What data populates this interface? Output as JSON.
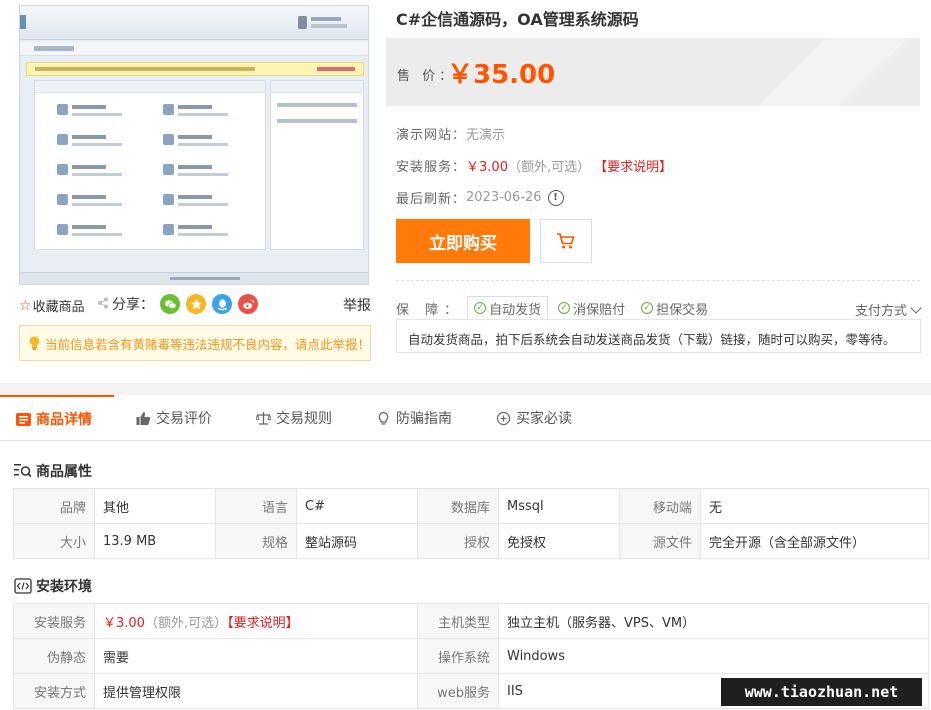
{
  "product": {
    "title": "C#企信通源码，OA管理系统源码",
    "price_label": "售 价：",
    "price": "￥35.00"
  },
  "info": {
    "demo_label": "演示网站：",
    "demo_value": "无演示",
    "install_label": "安装服务：",
    "install_price": "￥3.00",
    "install_note": "（额外,可选）",
    "install_link": "【要求说明】",
    "refresh_label": "最后刷新：",
    "refresh_value": "2023-06-26"
  },
  "buttons": {
    "buy": "立即购买"
  },
  "left": {
    "fav": "收藏商品",
    "share": "分享：",
    "report": "举报",
    "warning": "当前信息若含有黄赌毒等违法违规不良内容，请点此举报！"
  },
  "guarantee": {
    "label": "保 障：",
    "items": [
      "自动发货",
      "消保赔付",
      "担保交易"
    ],
    "pay_way": "支付方式",
    "desc": "自动发货商品，拍下后系统会自动发送商品发货（下载）链接，随时可以购买，零等待。"
  },
  "tabs": [
    "商品详情",
    "交易评价",
    "交易规则",
    "防骗指南",
    "买家必读"
  ],
  "attributes": {
    "title": "商品属性",
    "rows": [
      [
        [
          "品牌",
          "其他"
        ],
        [
          "语言",
          "C#"
        ],
        [
          "数据库",
          "Mssql"
        ],
        [
          "移动端",
          "无"
        ]
      ],
      [
        [
          "大小",
          "13.9 MB"
        ],
        [
          "规格",
          "整站源码"
        ],
        [
          "授权",
          "免授权"
        ],
        [
          "源文件",
          "完全开源（含全部源文件）"
        ]
      ]
    ]
  },
  "environment": {
    "title": "安装环境",
    "install_label": "安装服务",
    "install_price": "￥3.00",
    "install_note": "（额外,可选）",
    "install_link": "【要求说明】",
    "host_label": "主机类型",
    "host_value": "独立主机（服务器、VPS、VM）",
    "pseudo_label": "伪静态",
    "pseudo_value": "需要",
    "os_label": "操作系统",
    "os_value": "Windows",
    "method_label": "安装方式",
    "method_value": "提供管理权限",
    "web_label": "web服务",
    "web_value": "IIS"
  },
  "watermark": "www.tiaozhuan.net",
  "colors": {
    "accent": "#ff5400",
    "buy_button": "#ff7a0a",
    "warning_text": "#f0961c",
    "link_red": "#e02020",
    "check_green": "#6aaa3a"
  }
}
